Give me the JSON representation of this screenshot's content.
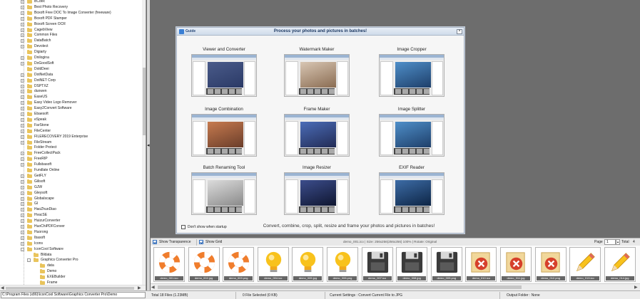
{
  "tree": {
    "items": [
      {
        "label": "BCdoc",
        "depth": 1,
        "expander": "+"
      },
      {
        "label": "Best Photo Recovery",
        "depth": 1,
        "expander": "+"
      },
      {
        "label": "Boxoft Free DOC To Image Converter (freeware)",
        "depth": 1,
        "expander": "+"
      },
      {
        "label": "Boxoft PDF Stamper",
        "depth": 1,
        "expander": "+"
      },
      {
        "label": "Boxoft Screen OCR",
        "depth": 1,
        "expander": "+"
      },
      {
        "label": "CagebView",
        "depth": 1,
        "expander": "+"
      },
      {
        "label": "Common Files",
        "depth": 1,
        "expander": "+"
      },
      {
        "label": "DataBatch",
        "depth": 1,
        "expander": "+"
      },
      {
        "label": "Devolect",
        "depth": 1,
        "expander": "+"
      },
      {
        "label": "Digiarty",
        "depth": 1,
        "expander": ""
      },
      {
        "label": "Dnilogina",
        "depth": 1,
        "expander": "+"
      },
      {
        "label": "DoGoodSoft",
        "depth": 1,
        "expander": "+"
      },
      {
        "label": "DoldDeei",
        "depth": 1,
        "expander": ""
      },
      {
        "label": "DotNetData",
        "depth": 1,
        "expander": "+"
      },
      {
        "label": "DotNET Corp",
        "depth": 1,
        "expander": "+"
      },
      {
        "label": "DSPTXZ",
        "depth": 1,
        "expander": "+"
      },
      {
        "label": "duowen",
        "depth": 1,
        "expander": "+"
      },
      {
        "label": "EaseUS",
        "depth": 1,
        "expander": "+"
      },
      {
        "label": "Easy Video Logo Remover",
        "depth": 1,
        "expander": "+"
      },
      {
        "label": "Easy2Convert Software",
        "depth": 1,
        "expander": "+"
      },
      {
        "label": "Ebaesoft",
        "depth": 1,
        "expander": "+"
      },
      {
        "label": "eSpeak",
        "depth": 1,
        "expander": "+"
      },
      {
        "label": "FarStone",
        "depth": 1,
        "expander": "+"
      },
      {
        "label": "FileCenter",
        "depth": 1,
        "expander": "+"
      },
      {
        "label": "FILERECOVERY 2019 Enterprise",
        "depth": 1,
        "expander": "+"
      },
      {
        "label": "FileStream",
        "depth": 1,
        "expander": "+"
      },
      {
        "label": "Folder Protect",
        "depth": 1,
        "expander": ""
      },
      {
        "label": "FreeCollectPack",
        "depth": 1,
        "expander": "+"
      },
      {
        "label": "FreeRIP",
        "depth": 1,
        "expander": "+"
      },
      {
        "label": "Fullsbasoft",
        "depth": 1,
        "expander": "+"
      },
      {
        "label": "Fundlate Online",
        "depth": 1,
        "expander": ""
      },
      {
        "label": "GetFLY",
        "depth": 1,
        "expander": "+"
      },
      {
        "label": "Gilisoft",
        "depth": 1,
        "expander": "+"
      },
      {
        "label": "GJW",
        "depth": 1,
        "expander": "+"
      },
      {
        "label": "Gleysoft",
        "depth": 1,
        "expander": "+"
      },
      {
        "label": "Globalscape",
        "depth": 1,
        "expander": "+"
      },
      {
        "label": "GI",
        "depth": 1,
        "expander": "+"
      },
      {
        "label": "HaoZhuoDiao",
        "depth": 1,
        "expander": "+"
      },
      {
        "label": "HvacSE",
        "depth": 1,
        "expander": "+"
      },
      {
        "label": "HuizurConverter",
        "depth": 1,
        "expander": "+"
      },
      {
        "label": "HuoChiPDFConver",
        "depth": 1,
        "expander": "+"
      },
      {
        "label": "Huorong",
        "depth": 1,
        "expander": "+"
      },
      {
        "label": "Ibasoft",
        "depth": 1,
        "expander": "+"
      },
      {
        "label": "Icons",
        "depth": 1,
        "expander": "+"
      },
      {
        "label": "IconCool Software",
        "depth": 1,
        "expander": "-"
      },
      {
        "label": "Bildata",
        "depth": 2,
        "expander": ""
      },
      {
        "label": "Graphics Converter Pro",
        "depth": 2,
        "expander": "-"
      },
      {
        "label": "data",
        "depth": 3,
        "expander": ""
      },
      {
        "label": "Demo",
        "depth": 3,
        "expander": ""
      },
      {
        "label": "EXEBuilder",
        "depth": 3,
        "expander": ""
      },
      {
        "label": "Frame",
        "depth": 3,
        "expander": ""
      }
    ]
  },
  "guide": {
    "title": "Guide",
    "heading": "Process your photos and pictures in batches!",
    "close": "×",
    "tools": [
      {
        "label": "Viewer and Converter"
      },
      {
        "label": "Watermark Maker"
      },
      {
        "label": "Image Cropper"
      },
      {
        "label": "Image Combination"
      },
      {
        "label": "Frame Maker"
      },
      {
        "label": "Image Splitter"
      },
      {
        "label": "Batch Renaming Tool"
      },
      {
        "label": "Image Resizer"
      },
      {
        "label": "EXIF Reader"
      }
    ],
    "dont_show": "Don't show when startup",
    "footer": "Convert, combine, crop, split, resize and frame your photos and pictures in batches!"
  },
  "toolbar": {
    "show_transparence": "Show Transparence",
    "show_grid": "Show Grid",
    "info": "demo_001.ico  |  Size: 256x256(256x256) 100%  |  Rotate: Original",
    "page_label": "Page",
    "page_value": "1",
    "total_label": "Total",
    "total_value": "4"
  },
  "thumbnails": [
    {
      "caption": "demo_001.ico",
      "icon": "lifebuoy-icon"
    },
    {
      "caption": "demo_002.jpg",
      "icon": "lifebuoy-icon"
    },
    {
      "caption": "demo_003.png",
      "icon": "lifebuoy-icon"
    },
    {
      "caption": "demo_004.ico",
      "icon": "lightbulb-icon"
    },
    {
      "caption": "demo_005.jpg",
      "icon": "lightbulb-icon"
    },
    {
      "caption": "demo_006.png",
      "icon": "lightbulb-icon"
    },
    {
      "caption": "demo_007.ico",
      "icon": "floppy-icon"
    },
    {
      "caption": "demo_008.jpg",
      "icon": "floppy-icon"
    },
    {
      "caption": "demo_009.png",
      "icon": "floppy-icon"
    },
    {
      "caption": "demo_010.ico",
      "icon": "delete-document-icon"
    },
    {
      "caption": "demo_011.jpg",
      "icon": "delete-document-icon"
    },
    {
      "caption": "demo_012.png",
      "icon": "delete-document-icon"
    },
    {
      "caption": "demo_013.ico",
      "icon": "pencil-icon"
    },
    {
      "caption": "demo_014.jpg",
      "icon": "pencil-icon"
    }
  ],
  "status": {
    "path": "C:\\Program Files (x86)\\IconCool Software\\Graphics Converter Pro\\Demo",
    "total": "Total 18 Files (1.23MB)",
    "selected": "0 File Selected (0 KB)",
    "settings": "Current Settings : Convert Current File to JPG",
    "output": "Output Folder : None"
  },
  "colors": {
    "accent": "#3a7fd4",
    "workspace": "#6d6d6d",
    "folder": "#e9c45c"
  }
}
